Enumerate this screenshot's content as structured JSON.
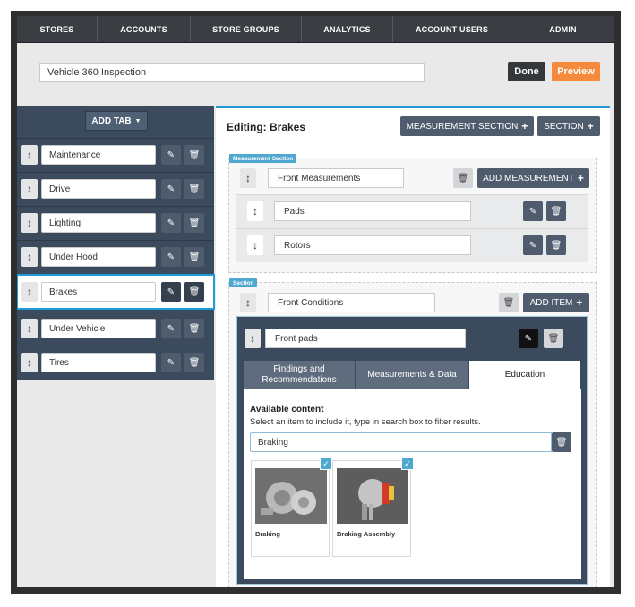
{
  "nav": [
    "STORES",
    "ACCOUNTS",
    "STORE GROUPS",
    "ANALYTICS",
    "ACCOUNT USERS",
    "ADMIN"
  ],
  "inspection_title": "Vehicle 360 Inspection",
  "done_label": "Done",
  "preview_label": "Preview",
  "add_tab_label": "ADD TAB",
  "tabs": [
    "Maintenance",
    "Drive",
    "Lighting",
    "Under Hood",
    "Brakes",
    "Under Vehicle",
    "Tires"
  ],
  "active_tab": "Brakes",
  "editing_title": "Editing: Brakes",
  "measurement_section_btn": "MEASUREMENT SECTION",
  "section_btn": "SECTION",
  "measurement_section": {
    "label": "Measurement Section",
    "name": "Front Measurements",
    "add_measurement_btn": "ADD MEASUREMENT",
    "measurements": [
      "Pads",
      "Rotors"
    ]
  },
  "section": {
    "label": "Section",
    "name": "Front Conditions",
    "add_item_btn": "ADD ITEM",
    "item": {
      "name": "Front pads",
      "tabs": [
        "Findings and Recommendations",
        "Measurements & Data",
        "Education"
      ],
      "active_tab": "Education",
      "available_title": "Available content",
      "available_help": "Select an item to include it, type in search box to filter results.",
      "search_value": "Braking",
      "content": [
        "Braking",
        "Braking Assembly"
      ]
    }
  },
  "colors": {
    "accent": "#1e9ad6",
    "nav_bg": "#3a3d42",
    "panel": "#3b4a5c",
    "preview": "#f58a3d",
    "label_badge": "#4fa8cf"
  },
  "icons": {
    "drag": "vertical-arrow-icon",
    "edit": "pencil-icon",
    "delete": "trash-icon",
    "add": "plus-icon",
    "caret": "caret-down-icon",
    "check": "checkmark-icon"
  }
}
